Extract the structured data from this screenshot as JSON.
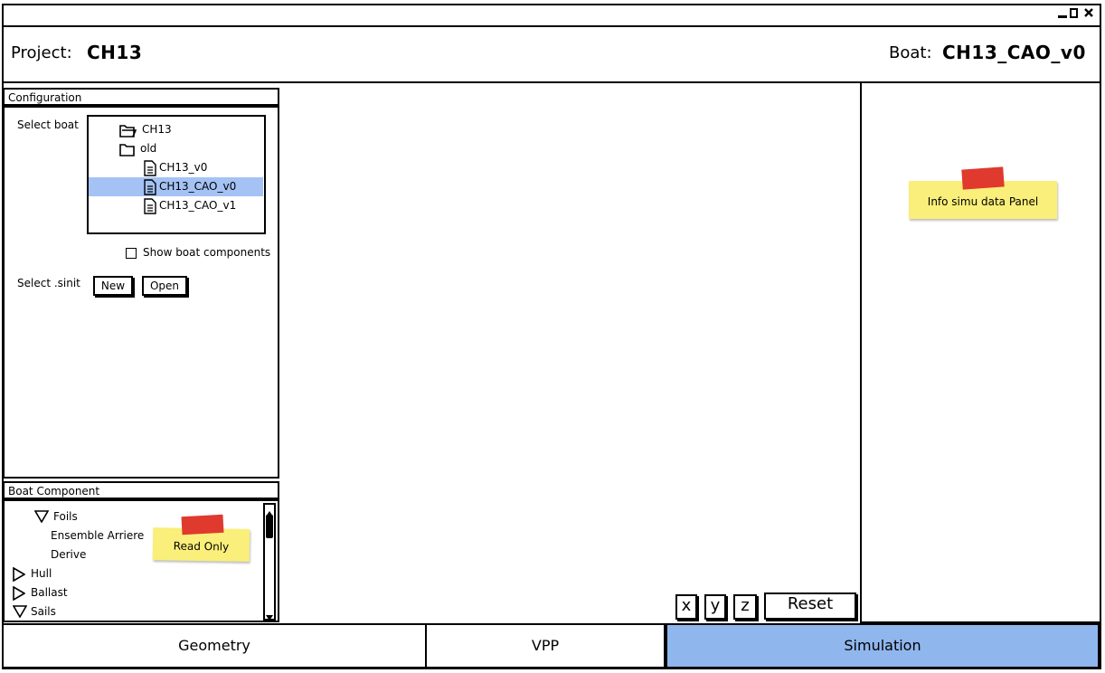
{
  "window_controls": {
    "minimize": "–",
    "maximize": "□",
    "close": "✕"
  },
  "header": {
    "project_label": "Project:",
    "project_value": "CH13",
    "boat_label": "Boat:",
    "boat_value": "CH13_CAO_v0"
  },
  "configuration": {
    "title": "Configuration",
    "select_boat_label": "Select boat",
    "tree": [
      {
        "label": "CH13",
        "icon": "folder-open-icon",
        "selected": false
      },
      {
        "label": "old",
        "icon": "folder-icon",
        "selected": false
      },
      {
        "label": "CH13_v0",
        "icon": "file-icon",
        "selected": false
      },
      {
        "label": "CH13_CAO_v0",
        "icon": "file-icon",
        "selected": true
      },
      {
        "label": "CH13_CAO_v1",
        "icon": "file-icon",
        "selected": false
      }
    ],
    "show_components_label": "Show boat components",
    "show_components_checked": false,
    "select_sinit_label": "Select .sinit",
    "new_label": "New",
    "open_label": "Open"
  },
  "boat_component": {
    "title": "Boat Component",
    "items": [
      {
        "label": "Foils",
        "icon": "triangle-down-icon",
        "expanded": true
      },
      {
        "label": "Ensemble Arriere",
        "icon": "",
        "expanded": false
      },
      {
        "label": "Derive",
        "icon": "",
        "expanded": false
      },
      {
        "label": "Hull",
        "icon": "triangle-right-icon",
        "expanded": false
      },
      {
        "label": "Ballast",
        "icon": "triangle-right-icon",
        "expanded": false
      },
      {
        "label": "Sails",
        "icon": "triangle-down-icon",
        "expanded": true
      }
    ],
    "note": "Read Only"
  },
  "viewport": {
    "x_label": "x",
    "y_label": "y",
    "z_label": "z",
    "reset_label": "Reset"
  },
  "info_panel": {
    "note": "Info simu data Panel"
  },
  "tabs": [
    {
      "label": "Geometry",
      "active": false
    },
    {
      "label": "VPP",
      "active": false
    },
    {
      "label": "Simulation",
      "active": true
    }
  ],
  "colors": {
    "selected_row": "#a4c2f4",
    "active_tab": "#90b6ee",
    "sticky_note": "#f9ef7a",
    "tape": "#e0392e"
  }
}
